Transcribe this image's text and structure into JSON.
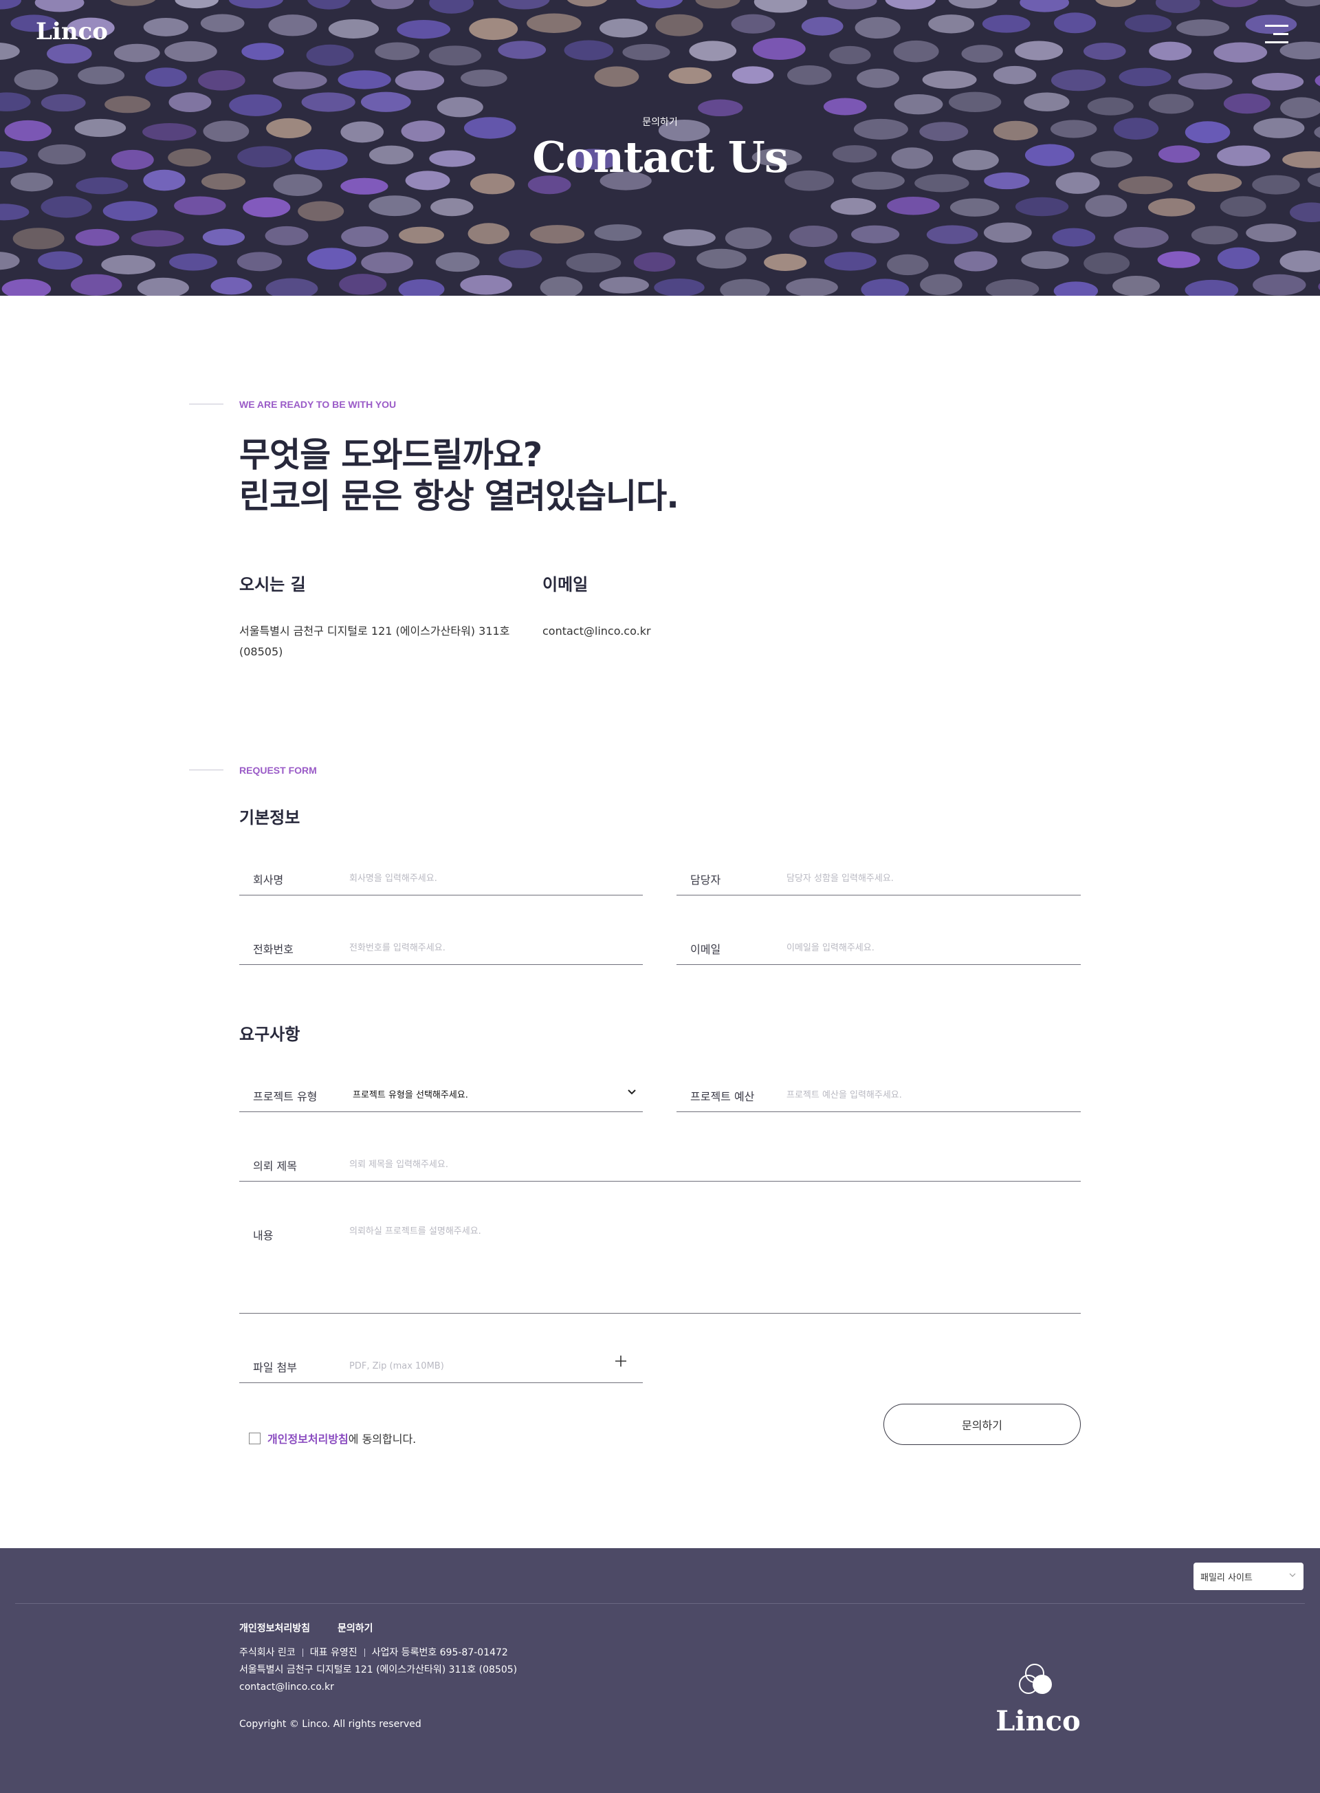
{
  "header": {
    "logo": "Linco",
    "menu_icon": "hamburger-menu-icon",
    "subtitle": "문의하기",
    "title": "Contact Us"
  },
  "intro": {
    "eyebrow": "WE ARE READY TO BE WITH YOU",
    "headline_line1": "무엇을 도와드릴까요?",
    "headline_line2": "린코의 문은 항상 열려있습니다.",
    "location": {
      "title": "오시는 길",
      "address_line1": "서울특별시 금천구 디지털로 121 (에이스가산타워) 311호",
      "address_line2": "(08505)"
    },
    "email": {
      "title": "이메일",
      "value": "contact@linco.co.kr"
    }
  },
  "form": {
    "eyebrow": "REQUEST FORM",
    "basic_title": "기본정보",
    "company": {
      "label": "회사명",
      "placeholder": "회사명을 입력해주세요."
    },
    "manager": {
      "label": "담당자",
      "placeholder": "담당자 성함을 입력해주세요."
    },
    "phone": {
      "label": "전화번호",
      "placeholder": "전화번호를 입력해주세요."
    },
    "email": {
      "label": "이메일",
      "placeholder": "이메일을 입력해주세요."
    },
    "requirements_title": "요구사항",
    "project_type": {
      "label": "프로젝트 유형",
      "selected": "프로젝트 유형을 선택해주세요."
    },
    "budget": {
      "label": "프로젝트 예산",
      "placeholder": "프로젝트 예산을 입력해주세요."
    },
    "subject": {
      "label": "의뢰 제목",
      "placeholder": "의뢰 제목을 입력해주세요."
    },
    "content": {
      "label": "내용",
      "placeholder": "의뢰하실 프로젝트를 설명해주세요."
    },
    "file": {
      "label": "파일 첨부",
      "placeholder": "PDF, Zip (max 10MB)"
    },
    "agree_link": "개인정보처리방침",
    "agree_text": "에 동의합니다.",
    "submit": "문의하기"
  },
  "footer": {
    "family_site": "패밀리 사이트",
    "links": [
      "개인정보처리방침",
      "문의하기"
    ],
    "company": "주식회사 린코",
    "ceo": "대표 유영진",
    "business_no": "사업자 등록번호 695-87-01472",
    "address": "서울특별시 금천구 디지털로 121 (에이스가산타워) 311호 (08505)",
    "email": "contact@linco.co.kr",
    "copyright": "Copyright © Linco. All rights reserved",
    "logo": "Linco"
  },
  "colors": {
    "hero_bg": "#2d2b40",
    "accent": "#9a5bc7",
    "footer_bg": "#4d4a66",
    "heading": "#27283b"
  }
}
